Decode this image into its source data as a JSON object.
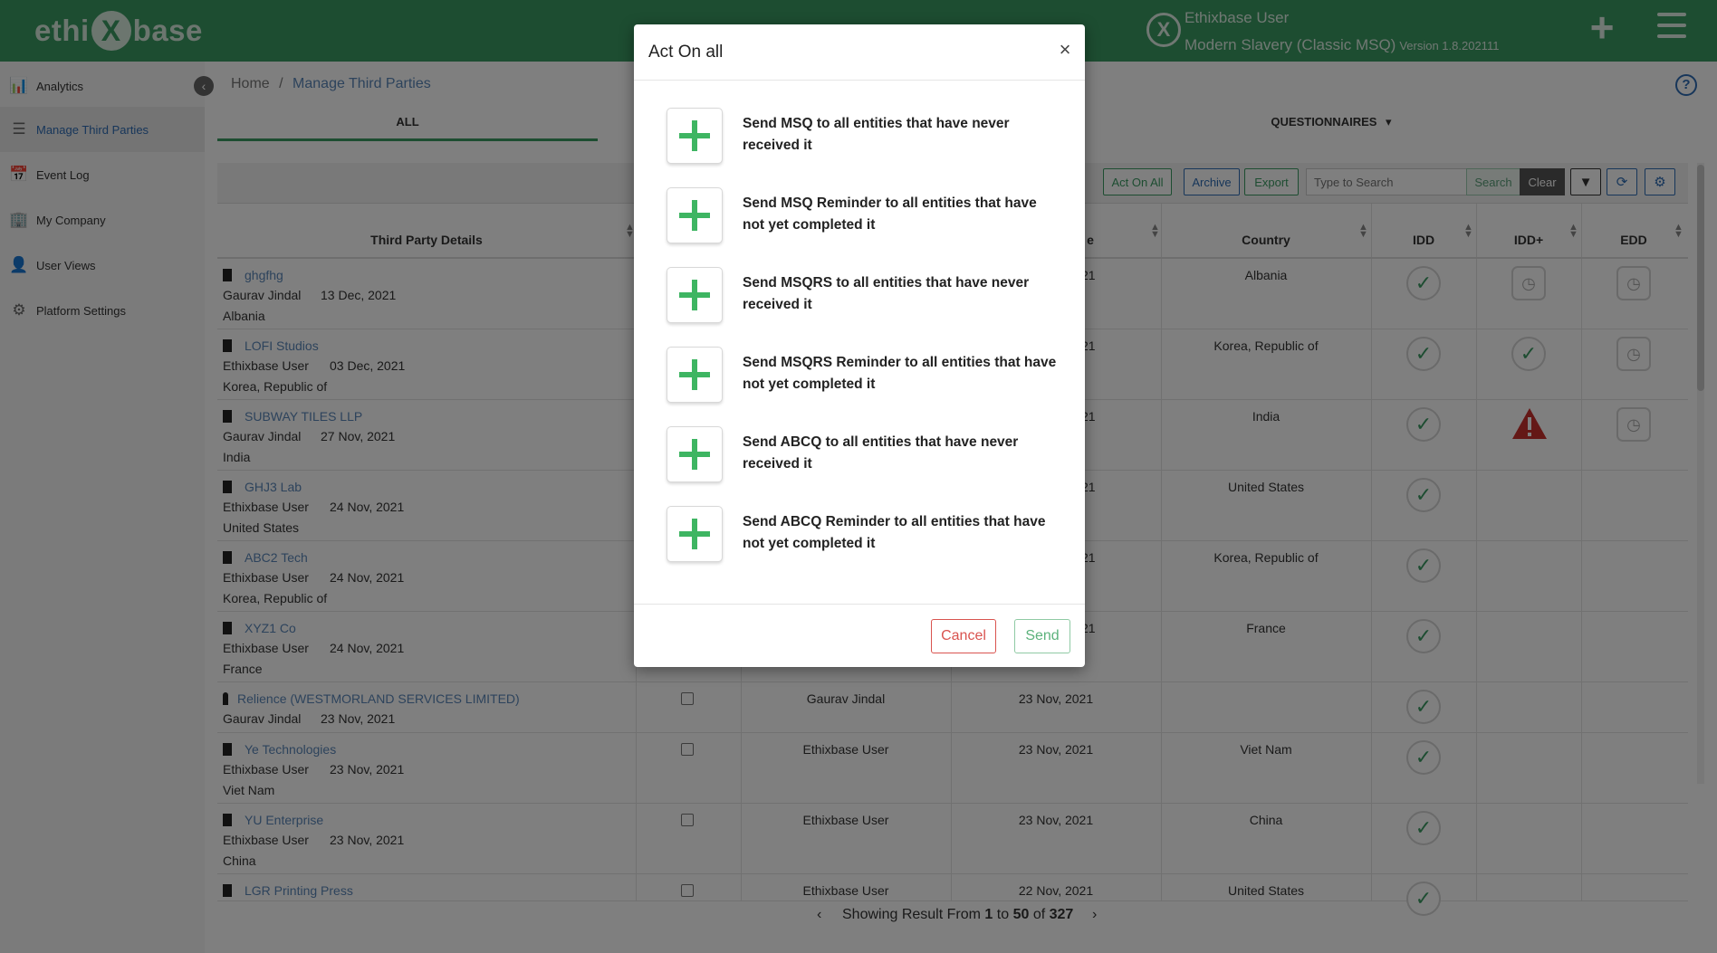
{
  "header": {
    "logo_left": "ethi",
    "logo_x": "X",
    "logo_right": "base",
    "user_icon": "X",
    "user_name": "Ethixbase User",
    "module": "Modern Slavery (Classic MSQ)",
    "version": "Version 1.8.202111",
    "add_icon": "+",
    "menu_icon": "hamburger-icon"
  },
  "sidebar": {
    "collapse_icon": "‹",
    "items": [
      {
        "label": "Analytics",
        "icon": "📊",
        "icon_name": "bar-chart-icon",
        "active": false
      },
      {
        "label": "Manage Third Parties",
        "icon": "☰",
        "icon_name": "list-icon",
        "active": true
      },
      {
        "label": "Event Log",
        "icon": "📅",
        "icon_name": "calendar-plus-icon",
        "active": false
      },
      {
        "label": "My Company",
        "icon": "🏢",
        "icon_name": "building-icon",
        "active": false
      },
      {
        "label": "User Views",
        "icon": "👤",
        "icon_name": "user-icon",
        "active": false
      },
      {
        "label": "Platform Settings",
        "icon": "⚙",
        "icon_name": "gear-icon",
        "active": false
      }
    ]
  },
  "breadcrumb": {
    "home": "Home",
    "sep": "/",
    "current": "Manage Third Parties"
  },
  "help_icon": "?",
  "tabs": {
    "all": "ALL",
    "questionnaires": "QUESTIONNAIRES",
    "questionnaires_caret": "▾"
  },
  "toolbar": {
    "act_on_all": "Act On All",
    "archive": "Archive",
    "export": "Export",
    "search_placeholder": "Type to Search",
    "search": "Search",
    "clear": "Clear",
    "filter_icon": "▼",
    "refresh_icon": "⟳",
    "settings_icon": "⚙"
  },
  "table": {
    "headers": {
      "details": "Third Party Details",
      "created_fragment": "e",
      "country": "Country",
      "idd": "IDD",
      "idd_plus": "IDD+",
      "edd": "EDD"
    },
    "rows": [
      {
        "name": "ghgfhg",
        "type": "company",
        "user": "Gaurav Jindal",
        "date": "13 Dec, 2021",
        "country_line": "Albania",
        "created_by": "",
        "created_on": "21",
        "country": "Albania",
        "idd": "ok",
        "idd_plus": "pending",
        "edd": "pending",
        "checkbox": false
      },
      {
        "name": "LOFI Studios",
        "type": "company",
        "user": "Ethixbase User",
        "date": "03 Dec, 2021",
        "country_line": "Korea, Republic of",
        "created_by": "",
        "created_on": "21",
        "country": "Korea, Republic of",
        "idd": "ok",
        "idd_plus": "ok",
        "edd": "pending",
        "checkbox": false
      },
      {
        "name": "SUBWAY TILES LLP",
        "type": "company",
        "user": "Gaurav Jindal",
        "date": "27 Nov, 2021",
        "country_line": "India",
        "created_by": "",
        "created_on": "21",
        "country": "India",
        "idd": "ok",
        "idd_plus": "warning",
        "edd": "pending",
        "checkbox": false
      },
      {
        "name": "GHJ3 Lab",
        "type": "company",
        "user": "Ethixbase User",
        "date": "24 Nov, 2021",
        "country_line": "United States",
        "created_by": "",
        "created_on": "21",
        "country": "United States",
        "idd": "ok",
        "idd_plus": "",
        "edd": "",
        "checkbox": false
      },
      {
        "name": "ABC2 Tech",
        "type": "company",
        "user": "Ethixbase User",
        "date": "24 Nov, 2021",
        "country_line": "Korea, Republic of",
        "created_by": "",
        "created_on": "21",
        "country": "Korea, Republic of",
        "idd": "ok",
        "idd_plus": "",
        "edd": "",
        "checkbox": false
      },
      {
        "name": "XYZ1 Co",
        "type": "company",
        "user": "Ethixbase User",
        "date": "24 Nov, 2021",
        "country_line": "France",
        "created_by": "",
        "created_on": "21",
        "country": "France",
        "idd": "ok",
        "idd_plus": "",
        "edd": "",
        "checkbox": false
      },
      {
        "name": "Relience (WESTMORLAND SERVICES LIMITED)",
        "type": "person",
        "user": "Gaurav Jindal",
        "date": "23 Nov, 2021",
        "country_line": "",
        "created_by": "Gaurav Jindal",
        "created_on": "23 Nov, 2021",
        "country": "",
        "idd": "ok",
        "idd_plus": "",
        "edd": "",
        "checkbox": true
      },
      {
        "name": "Ye Technologies",
        "type": "company",
        "user": "Ethixbase User",
        "date": "23 Nov, 2021",
        "country_line": "Viet Nam",
        "created_by": "Ethixbase User",
        "created_on": "23 Nov, 2021",
        "country": "Viet Nam",
        "idd": "ok",
        "idd_plus": "",
        "edd": "",
        "checkbox": true
      },
      {
        "name": "YU Enterprise",
        "type": "company",
        "user": "Ethixbase User",
        "date": "23 Nov, 2021",
        "country_line": "China",
        "created_by": "Ethixbase User",
        "created_on": "23 Nov, 2021",
        "country": "China",
        "idd": "ok",
        "idd_plus": "",
        "edd": "",
        "checkbox": true
      },
      {
        "name": "LGR Printing Press",
        "type": "company",
        "user": "",
        "date": "",
        "country_line": "",
        "created_by": "Ethixbase User",
        "created_on": "22 Nov, 2021",
        "country": "United States",
        "idd": "ok",
        "idd_plus": "",
        "edd": "",
        "checkbox": true
      }
    ]
  },
  "pagination": {
    "prefix": "Showing Result From",
    "from": "1",
    "to_word": "to",
    "to": "50",
    "of_word": "of",
    "total": "327",
    "prev": "‹",
    "next": "›"
  },
  "modal": {
    "title": "Act On all",
    "close": "×",
    "options": [
      "Send MSQ to all entities that have never received it",
      "Send MSQ Reminder to all entities that have not yet completed it",
      "Send MSQRS to all entities that have never received it",
      "Send MSQRS Reminder to all entities that have not yet completed it",
      "Send ABCQ to all entities that have never received it",
      "Send ABCQ Reminder to all entities that have not yet completed it"
    ],
    "cancel": "Cancel",
    "send": "Send"
  },
  "colors": {
    "brand": "#3b9a62",
    "link": "#5a86b8",
    "plus": "#3eb562",
    "danger": "#d9534f",
    "warning": "#c9302c"
  }
}
